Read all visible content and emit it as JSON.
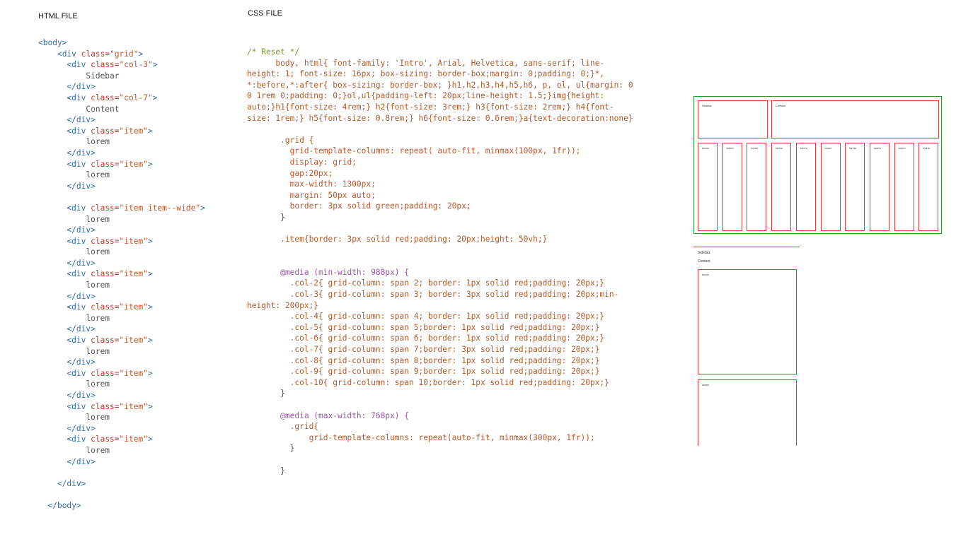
{
  "labels": {
    "html_title": "HTML FILE",
    "css_title": "CSS FILE"
  },
  "html_code": {
    "body_open": "<body>",
    "body_close": "</body>",
    "grid_class": "grid",
    "col3_class": "col-3",
    "col7_class": "col-7",
    "item_class": "item",
    "item_wide_class": "item item--wide",
    "sidebar_text": "Sidebar",
    "content_text": "Content",
    "lorem_text": "lorem"
  },
  "css_code": {
    "comment": "/* Reset */",
    "reset_lines": [
      "body, html{ font-family: 'Intro', Arial, Helvetica, sans-serif; line-",
      "height: 1; font-size: 16px; box-sizing: border-box;margin: 0;padding: 0;}*,",
      "*:before,*:after{ box-sizing: border-box; }h1,h2,h3,h4,h5,h6, p, ol, ul{margin: 0",
      "0 1rem 0;padding: 0;}ol,ul{padding-left: 20px;line-height: 1.5;}img{height:",
      "auto;}h1{font-size: 4rem;} h2{font-size: 3rem;} h3{font-size: 2rem;} h4{font-",
      "size: 1rem;} h5{font-size: 0.8rem;} h6{font-size: 0.6rem;}a{text-decoration:none}"
    ],
    "grid_selector": ".grid {",
    "grid_props": [
      "grid-template-columns: repeat( auto-fit, minmax(100px, 1fr));",
      "display: grid;",
      "gap:20px;",
      "max-width: 1300px;",
      "margin: 50px auto;",
      "border: 3px solid green;padding: 20px;"
    ],
    "close_brace": "}",
    "item_rule": ".item{border: 3px solid red;padding: 20px;height: 50vh;}",
    "media1": "@media (min-width: 988px) {",
    "media1_rules": [
      ".col-2{ grid-column: span 2; border: 1px solid red;padding: 20px;}",
      ".col-3{ grid-column: span 3; border: 3px solid red;padding: 20px;min-",
      "height: 200px;}",
      ".col-4{ grid-column: span 4; border: 1px solid red;padding: 20px;}",
      ".col-5{ grid-column: span 5;border: 1px solid red;padding: 20px;}",
      ".col-6{ grid-column: span 6; border: 1px solid red;padding: 20px;}",
      ".col-7{ grid-column: span 7;border: 3px solid red;padding: 20px;}",
      ".col-8{ grid-column: span 8;border: 1px solid red;padding: 20px;}",
      ".col-9{ grid-column: span 9;border: 1px solid red;padding: 20px;}",
      ".col-10{ grid-column: span 10;border: 1px solid red;padding: 20px;}"
    ],
    "media2": "@media (max-width: 768px) {",
    "media2_selector": ".grid{",
    "media2_prop": "grid-template-columns: repeat(auto-fit, minmax(300px, 1fr));"
  },
  "preview_wide": {
    "sidebar": "Sidebar",
    "content": "Content",
    "items": [
      "lorem",
      "lorem",
      "lorem",
      "lorem",
      "lorem",
      "lorem",
      "lorem",
      "lorem",
      "lorem",
      "lorem"
    ]
  },
  "preview_narrow": {
    "sidebar": "Sidebar",
    "content": "Content",
    "items": [
      "lorem",
      "lorem"
    ]
  },
  "colors": {
    "green_border": "#2e9a2e",
    "red_border": "#e23b3b",
    "tag_blue": "#2f6fb0"
  }
}
